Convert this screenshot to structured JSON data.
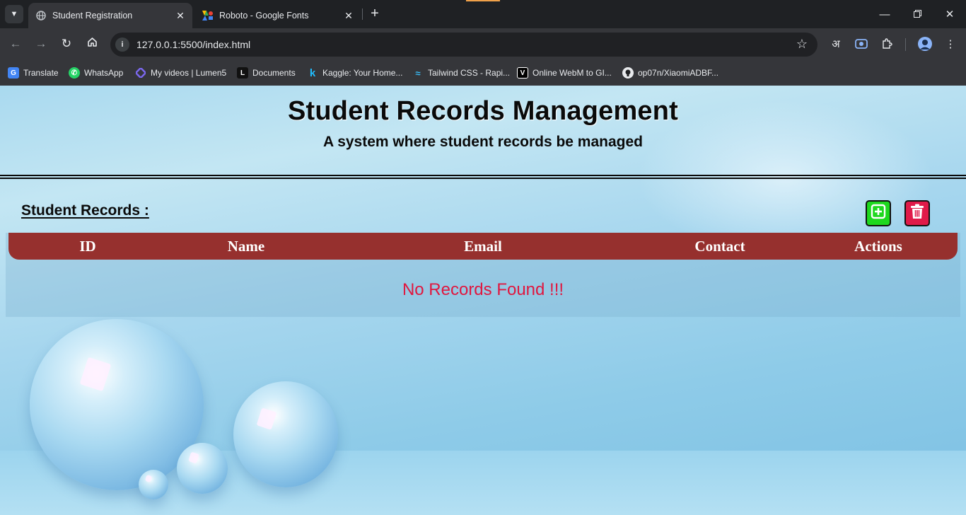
{
  "browser": {
    "tabs": [
      {
        "title": "Student Registration",
        "active": true
      },
      {
        "title": "Roboto - Google Fonts",
        "active": false
      }
    ],
    "url": "127.0.0.1:5500/index.html",
    "bookmarks": [
      {
        "label": "Translate",
        "icon": "google-translate-icon"
      },
      {
        "label": "WhatsApp",
        "icon": "whatsapp-icon"
      },
      {
        "label": "My videos | Lumen5",
        "icon": "lumen5-icon"
      },
      {
        "label": "Documents",
        "icon": "documents-icon"
      },
      {
        "label": "Kaggle: Your Home...",
        "icon": "kaggle-icon"
      },
      {
        "label": "Tailwind CSS - Rapi...",
        "icon": "tailwind-icon"
      },
      {
        "label": "Online WebM to GI...",
        "icon": "v-icon"
      },
      {
        "label": "op07n/XiaomiADBF...",
        "icon": "github-icon"
      }
    ],
    "toolbar_lang_glyph": "अ"
  },
  "page": {
    "title": "Student Records Management",
    "subtitle": "A system where student records be managed",
    "section_title": "Student Records :",
    "table": {
      "headers": [
        "ID",
        "Name",
        "Email",
        "Contact",
        "Actions"
      ],
      "empty_message": "No Records Found !!!"
    },
    "colors": {
      "header_bar": "#96302e",
      "add_button": "#1ed81e",
      "delete_button": "#e01a49",
      "empty_text": "#e0173f"
    }
  }
}
